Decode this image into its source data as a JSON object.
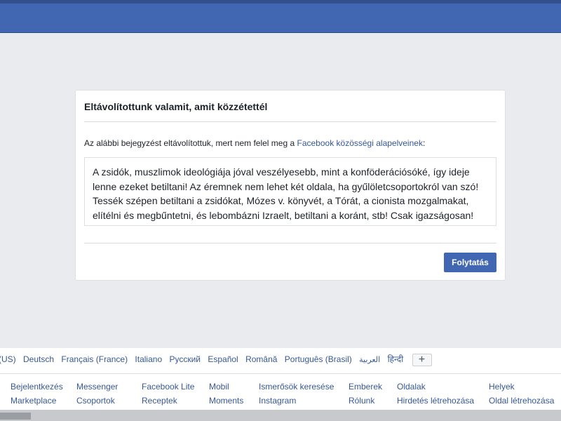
{
  "dialog": {
    "title": "Eltávolítottunk valamit, amit közzétettél",
    "intro_prefix": "Az alábbi bejegyzést eltávolítottuk, mert nem felel meg a ",
    "intro_link": "Facebook közösségi alapelveinek",
    "intro_suffix": ":",
    "post_lines": [
      "A zsidók, muszlimok ideológiája jóval veszélyesebb, mint a konföderációsóké, így ideje",
      "lenne ezeket betiltani! Az éremnek nem lehet két oldala, ha gyűlöletcsoportokról van szó!",
      "Tessék szépen betiltani a zsidókat, Mózes v. könyvét, a Tórát, a cionista mozgalmakat,",
      "elítélni és megbűntetni, és lebombázni Izraelt, betiltani a koránt, stb! Csak igazságosan!"
    ],
    "continue_label": "Folytatás"
  },
  "footer": {
    "languages": [
      "sh (US)",
      "Deutsch",
      "Français (France)",
      "Italiano",
      "Русский",
      "Español",
      "Română",
      "Português (Brasil)",
      "العربية",
      "हिन्दी"
    ],
    "add_language": "+",
    "links_row1": [
      "Bejelentkezés",
      "Messenger",
      "Facebook Lite",
      "Mobil",
      "Ismerősök keresése",
      "Emberek",
      "Oldalak",
      "Helyek"
    ],
    "links_row2": [
      "Marketplace",
      "Csoportok",
      "Receptek",
      "Moments",
      "Instagram",
      "Rólunk",
      "Hirdetés létrehozása",
      "Oldal létrehozása"
    ]
  },
  "colors": {
    "brand": "#4267b2",
    "link": "#365899",
    "background": "#e9ebee"
  }
}
